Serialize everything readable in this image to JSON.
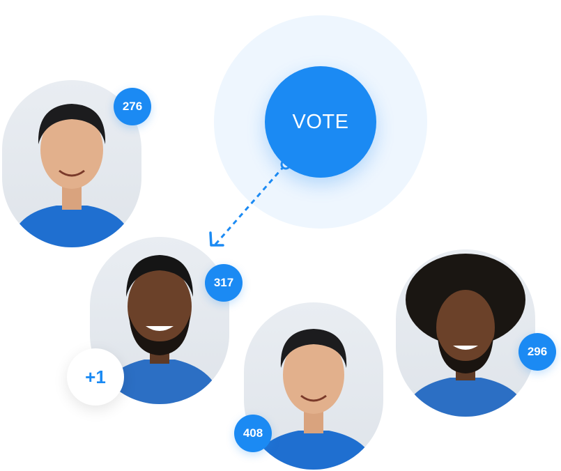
{
  "vote": {
    "label": "VOTE"
  },
  "increment": {
    "label": "+1"
  },
  "candidates": [
    {
      "votes": "276"
    },
    {
      "votes": "317"
    },
    {
      "votes": "408"
    },
    {
      "votes": "296"
    }
  ],
  "colors": {
    "accent": "#1b8af3",
    "halo": "#eef6fe",
    "shirt": "#1f6fd0"
  }
}
